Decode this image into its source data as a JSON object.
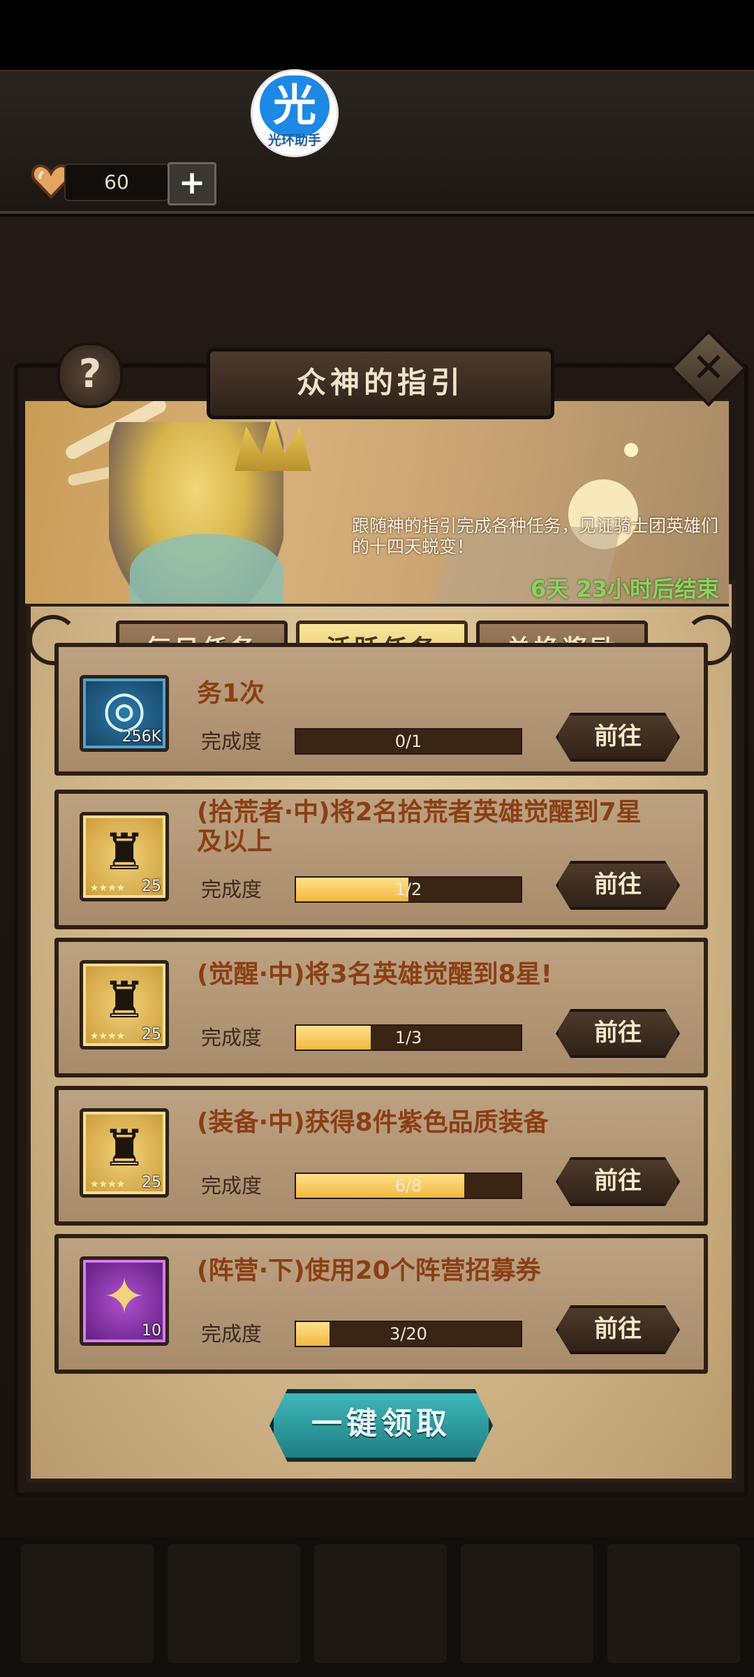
{
  "helper_badge": {
    "glyph": "光",
    "label": "光环助手"
  },
  "resource": {
    "value": "60",
    "plus_label": "+",
    "icon": "heart-icon"
  },
  "dialog": {
    "title": "众神的指引",
    "help_label": "?",
    "close_label": "✕"
  },
  "banner": {
    "description": "跟随神的指引完成各种任务，见证骑士团英雄们的十四天蜕变！",
    "timer": "6天 23小时后结束"
  },
  "tabs": [
    {
      "label": "每日任务",
      "active": false
    },
    {
      "label": "活跃任务",
      "active": true
    },
    {
      "label": "兑换奖励",
      "active": false
    }
  ],
  "tasks": [
    {
      "title": "务1次",
      "icon": "blue-orb-icon",
      "count": "256K",
      "progress_label": "完成度",
      "progress_text": "0/1",
      "progress_fraction": 0,
      "button": "前往"
    },
    {
      "title": "(拾荒者·中)将2名拾荒者英雄觉醒到7星及以上",
      "icon": "gold-helmet-icon",
      "count": "25",
      "progress_label": "完成度",
      "progress_text": "1/2",
      "progress_fraction": 0.5,
      "button": "前往"
    },
    {
      "title": "(觉醒·中)将3名英雄觉醒到8星!",
      "icon": "gold-helmet-icon",
      "count": "25",
      "progress_label": "完成度",
      "progress_text": "1/3",
      "progress_fraction": 0.333,
      "button": "前往"
    },
    {
      "title": "(装备·中)获得8件紫色品质装备",
      "icon": "gold-helmet-icon",
      "count": "25",
      "progress_label": "完成度",
      "progress_text": "6/8",
      "progress_fraction": 0.75,
      "button": "前往"
    },
    {
      "title": "(阵营·下)使用20个阵营招募券",
      "icon": "purple-ticket-icon",
      "count": "10",
      "progress_label": "完成度",
      "progress_text": "3/20",
      "progress_fraction": 0.15,
      "button": "前往"
    }
  ],
  "claim_all_label": "一键领取",
  "star_glyphs": "★★★★"
}
